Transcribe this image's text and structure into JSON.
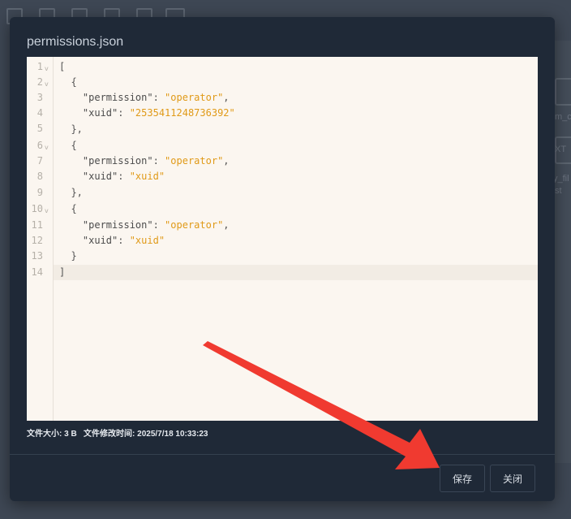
{
  "background": {
    "side_texts": [
      "m_c",
      "XT",
      "y_fil",
      "st"
    ]
  },
  "modal": {
    "title": "permissions.json",
    "editor": {
      "lines": [
        {
          "num": "1",
          "fold": true
        },
        {
          "num": "2",
          "fold": true
        },
        {
          "num": "3",
          "fold": false
        },
        {
          "num": "4",
          "fold": false
        },
        {
          "num": "5",
          "fold": false
        },
        {
          "num": "6",
          "fold": true
        },
        {
          "num": "7",
          "fold": false
        },
        {
          "num": "8",
          "fold": false
        },
        {
          "num": "9",
          "fold": false
        },
        {
          "num": "10",
          "fold": true
        },
        {
          "num": "11",
          "fold": false
        },
        {
          "num": "12",
          "fold": false
        },
        {
          "num": "13",
          "fold": false
        },
        {
          "num": "14",
          "fold": false
        }
      ],
      "code": {
        "l1": "[",
        "l2": "  {",
        "l3_key": "    \"permission\"",
        "l3_colon": ": ",
        "l3_val": "\"operator\"",
        "l3_end": ",",
        "l4_key": "    \"xuid\"",
        "l4_colon": ": ",
        "l4_val": "\"2535411248736392\"",
        "l5": "  },",
        "l6": "  {",
        "l7_key": "    \"permission\"",
        "l7_colon": ": ",
        "l7_val": "\"operator\"",
        "l7_end": ",",
        "l8_key": "    \"xuid\"",
        "l8_colon": ": ",
        "l8_val": "\"xuid\"",
        "l9": "  },",
        "l10": "  {",
        "l11_key": "    \"permission\"",
        "l11_colon": ": ",
        "l11_val": "\"operator\"",
        "l11_end": ",",
        "l12_key": "    \"xuid\"",
        "l12_colon": ": ",
        "l12_val": "\"xuid\"",
        "l13": "  }",
        "l14": "]"
      },
      "active_line": "14"
    },
    "status": {
      "size_label": "文件大小:",
      "size_value": "3 B",
      "mtime_label": "文件修改时间:",
      "mtime_value": "2025/7/18 10:33:23"
    },
    "buttons": {
      "save": "保存",
      "close": "关闭"
    }
  },
  "colors": {
    "modal_bg": "#1f2937",
    "editor_bg": "#fbf6f0",
    "string": "#e09a18",
    "arrow": "#f03a30"
  }
}
